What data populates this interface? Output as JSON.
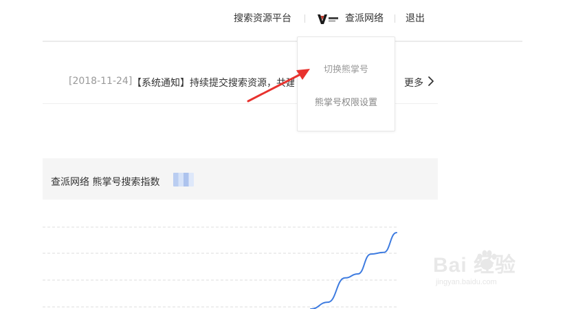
{
  "topnav": {
    "platform_label": "搜索资源平台",
    "account_name": "查派网络",
    "logout_label": "退出"
  },
  "notice": {
    "date": "[2018-11-24]",
    "text": "【系统通知】持续提交搜索资源，共建繁荣生态",
    "more_label": "更多"
  },
  "dropdown": {
    "items": [
      {
        "label": "切换熊掌号"
      },
      {
        "label": "熊掌号权限设置"
      }
    ]
  },
  "index_panel": {
    "title": "查派网络 熊掌号搜索指数",
    "value": "200"
  },
  "chart_data": {
    "type": "line",
    "series": [
      {
        "color": "#3d7be0",
        "points": [
          [
            0.0,
            0.0
          ],
          [
            0.2,
            0.12
          ],
          [
            0.4,
            0.55
          ],
          [
            0.55,
            0.62
          ],
          [
            0.7,
            0.97
          ],
          [
            0.85,
            1.0
          ],
          [
            1.0,
            1.35
          ]
        ]
      }
    ],
    "gridlines": 4,
    "grid": true
  },
  "watermark": {
    "main": "Bai  经验",
    "sub": "jingyan.baidu.com"
  }
}
